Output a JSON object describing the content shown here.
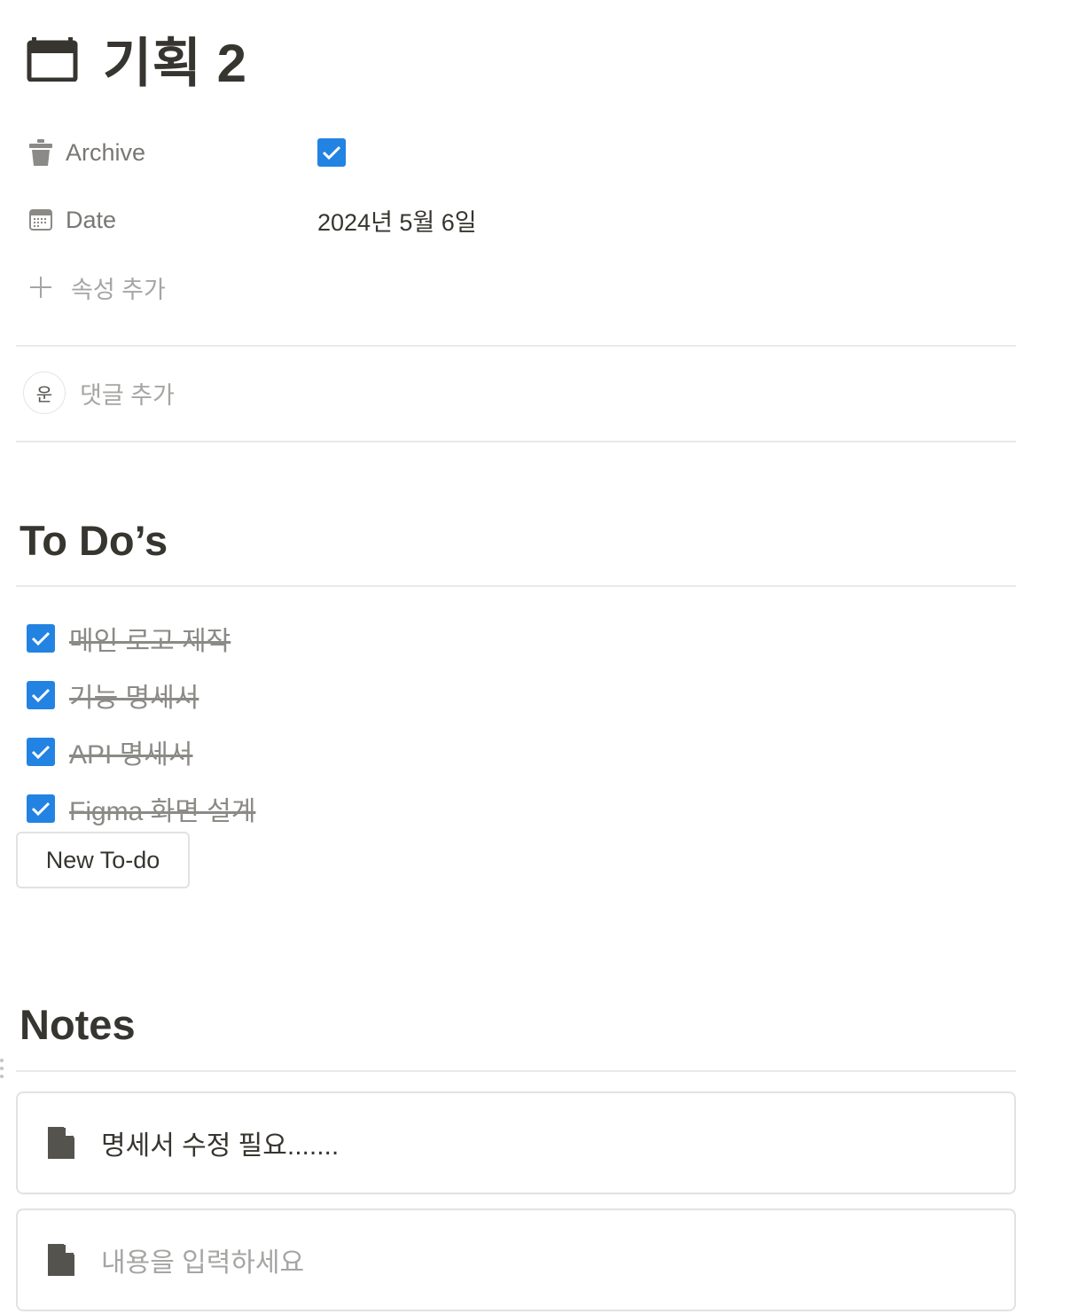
{
  "page": {
    "title_icon": "calendar-icon",
    "title": "기획 2"
  },
  "properties": [
    {
      "icon": "trash-icon",
      "label": "Archive",
      "type": "checkbox",
      "checked": true
    },
    {
      "icon": "calendar-icon",
      "label": "Date",
      "type": "date",
      "value": "2024년 5월 6일"
    }
  ],
  "add_property_label": "속성 추가",
  "comment": {
    "avatar_initial": "운",
    "placeholder": "댓글 추가"
  },
  "todos": {
    "heading": "To Do’s",
    "items": [
      {
        "text": "메인 로고 제작",
        "done": true
      },
      {
        "text": "기능 명세서",
        "done": true
      },
      {
        "text": "API 명세서",
        "done": true
      },
      {
        "text": "Figma 화면 설계",
        "done": true
      }
    ],
    "new_button_label": "New To-do"
  },
  "notes": {
    "heading": "Notes",
    "items": [
      {
        "icon": "document-icon",
        "text": "명세서 수정 필요.......",
        "placeholder": false
      },
      {
        "icon": "document-icon",
        "text": "내용을 입력하세요",
        "placeholder": true
      }
    ]
  },
  "colors": {
    "checkbox_blue": "#2383e2",
    "text_primary": "#37352f",
    "text_secondary": "#787774",
    "text_muted": "#a5a5a3",
    "divider": "#e9e9e7"
  }
}
